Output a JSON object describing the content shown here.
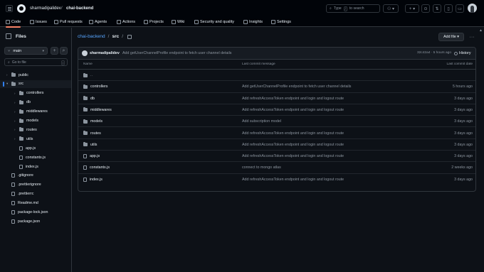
{
  "header": {
    "owner": "sharmadipalidev",
    "separator": "/",
    "repo": "chai-backend",
    "search_placeholder": "Type / to search",
    "slash_key": "/",
    "search_pre": "Type",
    "search_post": "to search"
  },
  "repo_nav": [
    {
      "label": "Code",
      "icon": "code-icon",
      "active": true
    },
    {
      "label": "Issues",
      "icon": "issue-icon"
    },
    {
      "label": "Pull requests",
      "icon": "pull-request-icon"
    },
    {
      "label": "Agents",
      "icon": "agent-icon"
    },
    {
      "label": "Actions",
      "icon": "actions-icon"
    },
    {
      "label": "Projects",
      "icon": "projects-icon"
    },
    {
      "label": "Wiki",
      "icon": "wiki-icon"
    },
    {
      "label": "Security and quality",
      "icon": "shield-icon"
    },
    {
      "label": "Insights",
      "icon": "graph-icon"
    },
    {
      "label": "Settings",
      "icon": "gear-icon"
    }
  ],
  "sidebar": {
    "title": "Files",
    "branch": "main",
    "add": "+",
    "goto_placeholder": "Go to file",
    "goto_key": "t",
    "tree": [
      {
        "label": "public",
        "type": "folder",
        "depth": 0
      },
      {
        "label": "src",
        "type": "folder",
        "depth": 0,
        "open": true,
        "selected": true
      },
      {
        "label": "controllers",
        "type": "folder",
        "depth": 1
      },
      {
        "label": "db",
        "type": "folder",
        "depth": 1
      },
      {
        "label": "middlewares",
        "type": "folder",
        "depth": 1
      },
      {
        "label": "models",
        "type": "folder",
        "depth": 1
      },
      {
        "label": "routes",
        "type": "folder",
        "depth": 1
      },
      {
        "label": "utils",
        "type": "folder",
        "depth": 1
      },
      {
        "label": "app.js",
        "type": "file",
        "depth": 1
      },
      {
        "label": "constants.js",
        "type": "file",
        "depth": 1
      },
      {
        "label": "index.js",
        "type": "file",
        "depth": 1
      },
      {
        "label": ".gitignore",
        "type": "file",
        "depth": 0
      },
      {
        "label": ".prettierignore",
        "type": "file",
        "depth": 0
      },
      {
        "label": ".prettierrc",
        "type": "file",
        "depth": 0
      },
      {
        "label": "Readme.md",
        "type": "file",
        "depth": 0
      },
      {
        "label": "package-lock.json",
        "type": "file",
        "depth": 0
      },
      {
        "label": "package.json",
        "type": "file",
        "depth": 0
      }
    ]
  },
  "breadcrumb": {
    "repo": "chai-backend",
    "sep": "/",
    "current": "src",
    "sep2": "/"
  },
  "actions": {
    "add_file": "Add file ▾",
    "more": "···"
  },
  "latest_commit": {
    "author": "sharmadipalidev",
    "message": "Add getUserChannelProfile endpoint to fetch user channel details",
    "meta": "32c42a4 · 5 hours ago",
    "history": "History"
  },
  "table": {
    "headers": [
      "Name",
      "Last commit message",
      "Last commit date"
    ],
    "parent": "..",
    "rows": [
      {
        "name": "controllers",
        "type": "folder",
        "message": "Add getUserChannelProfile endpoint to fetch user channel details",
        "date": "5 hours ago"
      },
      {
        "name": "db",
        "type": "folder",
        "message": "Add refreshAccessToken endpoint and login and logout route",
        "date": "3 days ago"
      },
      {
        "name": "middlewares",
        "type": "folder",
        "message": "Add refreshAccessToken endpoint and login and logout route",
        "date": "3 days ago"
      },
      {
        "name": "models",
        "type": "folder",
        "message": "Add subscription model",
        "date": "3 days ago"
      },
      {
        "name": "routes",
        "type": "folder",
        "message": "Add refreshAccessToken endpoint and login and logout route",
        "date": "3 days ago"
      },
      {
        "name": "utils",
        "type": "folder",
        "message": "Add refreshAccessToken endpoint and login and logout route",
        "date": "3 days ago"
      },
      {
        "name": "app.js",
        "type": "file",
        "message": "Add refreshAccessToken endpoint and login and logout route",
        "date": "3 days ago"
      },
      {
        "name": "constants.js",
        "type": "file",
        "message": "connect to mongo atlas",
        "date": "2 weeks ago"
      },
      {
        "name": "index.js",
        "type": "file",
        "message": "Add refreshAccessToken endpoint and login and logout route",
        "date": "3 days ago"
      }
    ]
  },
  "colors": {
    "link": "#58a6ff",
    "active_tab": "#f78166",
    "accent": "#2f81f7"
  }
}
